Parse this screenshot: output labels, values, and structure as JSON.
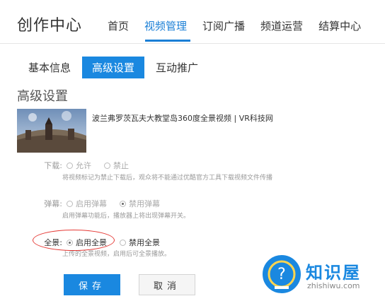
{
  "header": {
    "brand": "创作中心",
    "nav": [
      {
        "label": "首页",
        "active": false
      },
      {
        "label": "视频管理",
        "active": true
      },
      {
        "label": "订阅广播",
        "active": false
      },
      {
        "label": "频道运营",
        "active": false
      },
      {
        "label": "结算中心",
        "active": false
      }
    ]
  },
  "subtabs": [
    {
      "label": "基本信息",
      "active": false
    },
    {
      "label": "高级设置",
      "active": true
    },
    {
      "label": "互动推广",
      "active": false
    }
  ],
  "section_title": "高级设置",
  "video": {
    "title": "波兰弗罗茨瓦夫大教堂岛360度全景视频 | VR科技网"
  },
  "download": {
    "label": "下载:",
    "option_allow": "允许",
    "option_deny": "禁止",
    "hint": "将视频标记为禁止下载后，观众将不能通过优酷官方工具下载视频文件传播"
  },
  "danmaku": {
    "label": "弹幕:",
    "option_enable": "启用弹幕",
    "option_disable": "禁用弹幕",
    "hint": "启用弹幕功能后，播放器上将出现弹幕开关。"
  },
  "panorama": {
    "label": "全景:",
    "option_enable": "启用全景",
    "option_disable": "禁用全景",
    "selected": "启用全景",
    "hint": "上传的全景视频，启用后可全景播放。"
  },
  "actions": {
    "save": "保存",
    "cancel": "取消"
  },
  "watermark": {
    "name": "知识屋",
    "domain": "zhishiwu.com"
  },
  "colors": {
    "accent": "#1a88e0",
    "highlight": "#e53935"
  }
}
